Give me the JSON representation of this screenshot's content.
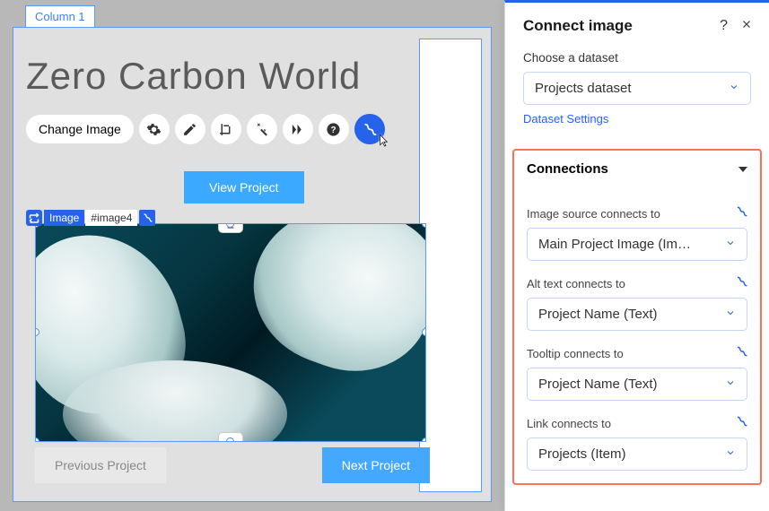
{
  "canvas": {
    "column_label": "Column 1",
    "page_title": "Zero Carbon World",
    "change_image_label": "Change Image",
    "view_project_label": "View Project",
    "selection_type": "Image",
    "selection_id": "#image4",
    "prev_label": "Previous Project",
    "next_label": "Next Project"
  },
  "panel": {
    "title": "Connect image",
    "choose_dataset_label": "Choose a dataset",
    "dataset_value": "Projects dataset",
    "dataset_settings_label": "Dataset Settings",
    "connections_header": "Connections",
    "fields": {
      "image_source": {
        "label": "Image source connects to",
        "value": "Main Project Image (Im…"
      },
      "alt_text": {
        "label": "Alt text connects to",
        "value": "Project Name (Text)"
      },
      "tooltip": {
        "label": "Tooltip connects to",
        "value": "Project Name (Text)"
      },
      "link": {
        "label": "Link connects to",
        "value": "Projects (Item)"
      }
    }
  }
}
